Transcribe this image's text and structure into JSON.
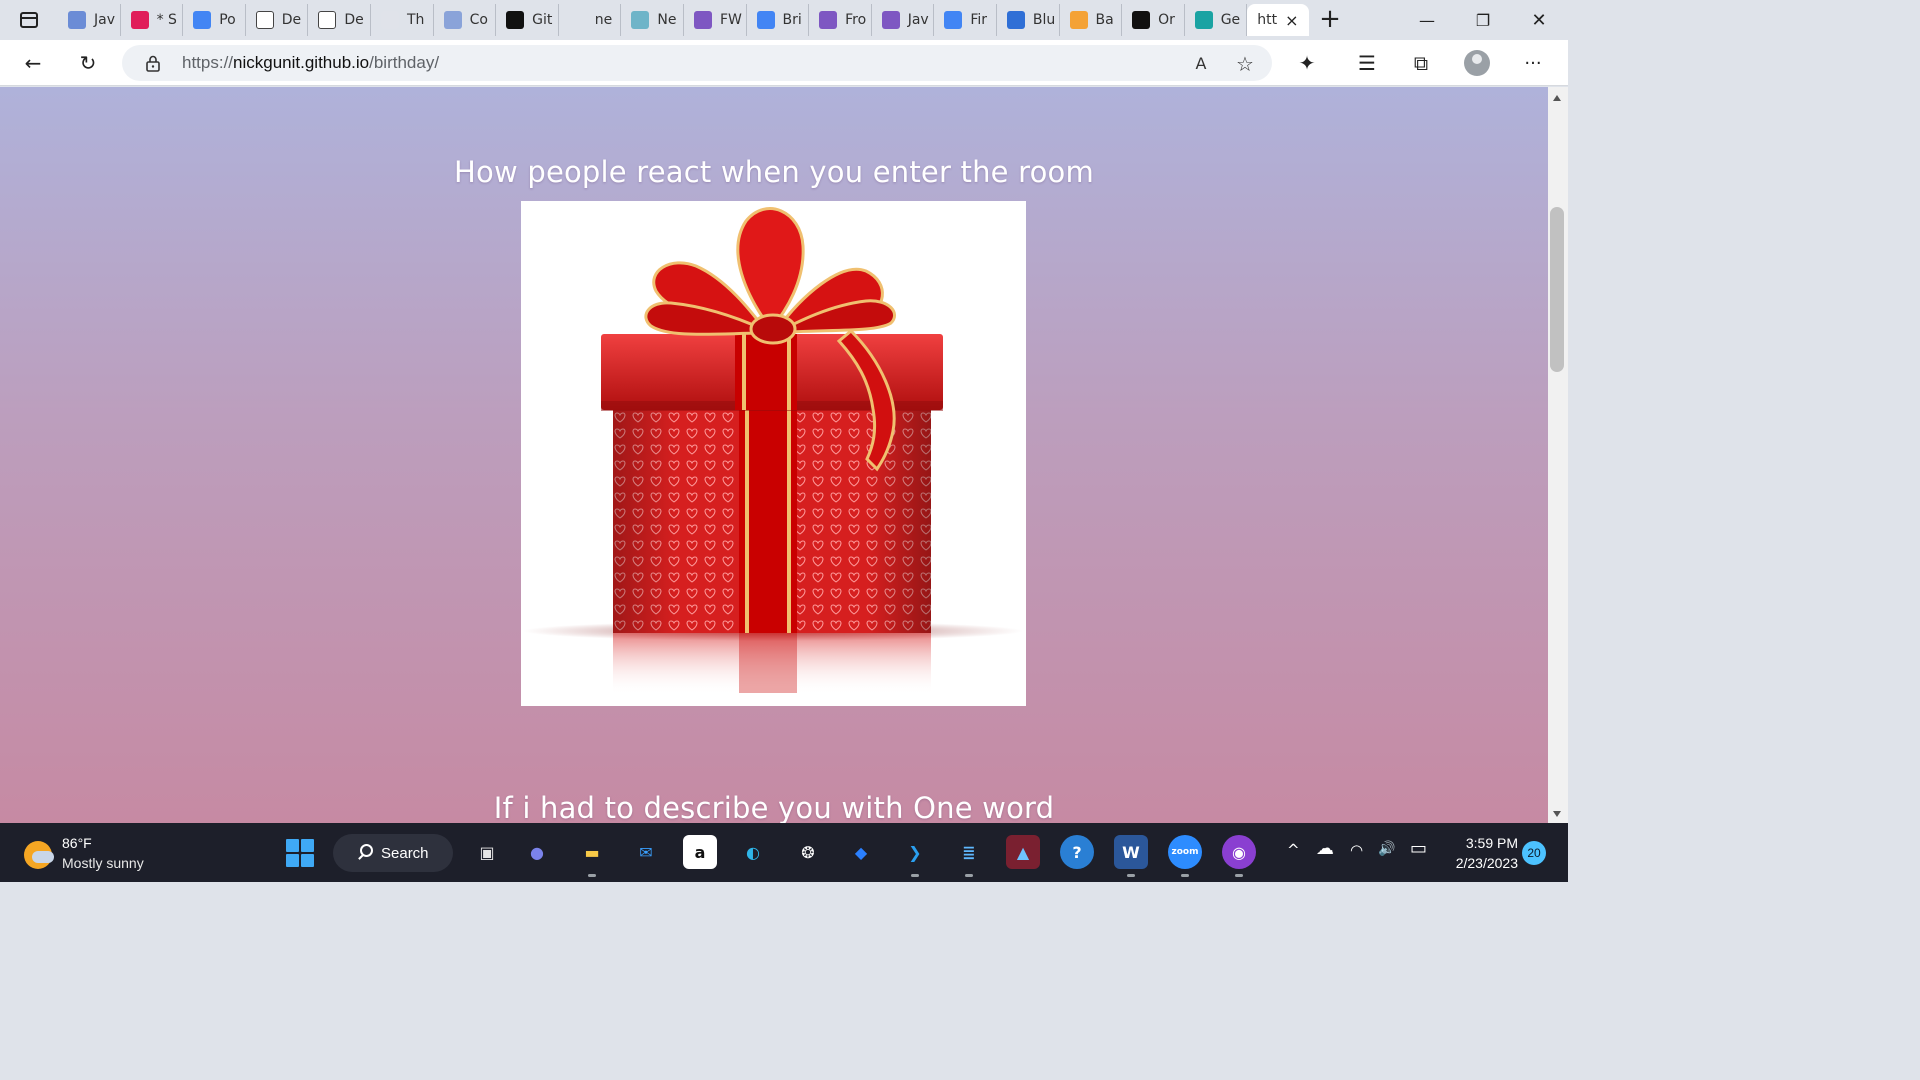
{
  "browser": {
    "tabs": [
      {
        "label": "Jav",
        "icon": "docs-icon",
        "color": "#6b8cd6"
      },
      {
        "label": "* S",
        "icon": "slack-icon",
        "color": "#e01e5a"
      },
      {
        "label": "Po",
        "icon": "docs-icon",
        "color": "#4285f4"
      },
      {
        "label": "De",
        "icon": "page-icon",
        "color": "#ffffff"
      },
      {
        "label": "De",
        "icon": "page-icon",
        "color": "#ffffff"
      },
      {
        "label": "Th",
        "icon": "cloud-icon",
        "color": "#e0e3ea"
      },
      {
        "label": "Co",
        "icon": "docs-icon",
        "color": "#8aa3d9"
      },
      {
        "label": "Git",
        "icon": "github-icon",
        "color": "#111111"
      },
      {
        "label": "ne",
        "icon": "search-icon",
        "color": "#dfe3ea"
      },
      {
        "label": "Ne",
        "icon": "diamond-icon",
        "color": "#6fb4c8"
      },
      {
        "label": "FW",
        "icon": "forms-icon",
        "color": "#7e57c2"
      },
      {
        "label": "Bri",
        "icon": "docs-icon",
        "color": "#4285f4"
      },
      {
        "label": "Fro",
        "icon": "forms-icon",
        "color": "#7e57c2"
      },
      {
        "label": "Jav",
        "icon": "forms-icon",
        "color": "#7e57c2"
      },
      {
        "label": "Fir",
        "icon": "docs-icon",
        "color": "#4285f4"
      },
      {
        "label": "Blu",
        "icon": "canva-icon",
        "color": "#2f6fd6"
      },
      {
        "label": "Ba",
        "icon": "image-icon",
        "color": "#f4a236"
      },
      {
        "label": "Or",
        "icon": "codepen-icon",
        "color": "#111111"
      },
      {
        "label": "Ge",
        "icon": "diamond-icon",
        "color": "#1aa3a3"
      }
    ],
    "active_tab": {
      "label": "htt",
      "close": "×"
    },
    "new_tab": "+",
    "window": {
      "minimize": "—",
      "restore": "❐",
      "close": "✕"
    },
    "url_prefix": "https://",
    "url_host": "nickgunit.github.io",
    "url_path": "/birthday/",
    "read_aloud": "A",
    "favorite": "☆",
    "extensions": "✦",
    "favorites_list": "☰",
    "collections": "⧉",
    "menu": "···",
    "back": "←",
    "refresh": "↻"
  },
  "page": {
    "heading_1": "How people react when you enter the room",
    "heading_2": "If i had to describe you with One word",
    "image_alt": "gift-box"
  },
  "taskbar": {
    "weather_temp": "86°F",
    "weather_desc": "Mostly sunny",
    "search_label": "Search",
    "apps": [
      {
        "name": "task-view",
        "glyph": "▣",
        "bg": "transparent",
        "fg": "#e6e6e6",
        "state": ""
      },
      {
        "name": "teams-chat",
        "glyph": "●",
        "bg": "transparent",
        "fg": "#7b83eb",
        "state": ""
      },
      {
        "name": "file-explorer",
        "glyph": "▬",
        "bg": "transparent",
        "fg": "#f7c948",
        "state": "running"
      },
      {
        "name": "mail",
        "glyph": "✉",
        "bg": "transparent",
        "fg": "#3aa0ff",
        "state": ""
      },
      {
        "name": "amazon",
        "glyph": "a",
        "bg": "#ffffff",
        "fg": "#111111",
        "state": ""
      },
      {
        "name": "edge",
        "glyph": "◐",
        "bg": "transparent",
        "fg": "#2fb5e8",
        "state": "active"
      },
      {
        "name": "chatgpt",
        "glyph": "❂",
        "bg": "transparent",
        "fg": "#ffffff",
        "state": ""
      },
      {
        "name": "dropbox",
        "glyph": "◆",
        "bg": "transparent",
        "fg": "#2b80ff",
        "state": ""
      },
      {
        "name": "vscode",
        "glyph": "❯",
        "bg": "transparent",
        "fg": "#2aa0f0",
        "state": "running"
      },
      {
        "name": "notepad",
        "glyph": "≣",
        "bg": "transparent",
        "fg": "#5fb8ff",
        "state": "running"
      },
      {
        "name": "photos",
        "glyph": "▲",
        "bg": "#7a2030",
        "fg": "#6fc3ff",
        "state": "alert"
      },
      {
        "name": "help",
        "glyph": "?",
        "bg": "#2a7fd4",
        "fg": "#ffffff",
        "state": "alert"
      },
      {
        "name": "word",
        "glyph": "W",
        "bg": "#2b579a",
        "fg": "#ffffff",
        "state": "running"
      },
      {
        "name": "zoom",
        "glyph": "zoom",
        "bg": "#2d8cff",
        "fg": "#ffffff",
        "state": "running"
      },
      {
        "name": "github-desktop",
        "glyph": "◉",
        "bg": "#8a3fd1",
        "fg": "#ffffff",
        "state": "running"
      }
    ],
    "tray": {
      "chevron": "^",
      "onedrive": "☁",
      "wifi": "◠",
      "volume": "🔊",
      "battery": "▭"
    },
    "time": "3:59 PM",
    "date": "2/23/2023",
    "notifications": "20"
  }
}
